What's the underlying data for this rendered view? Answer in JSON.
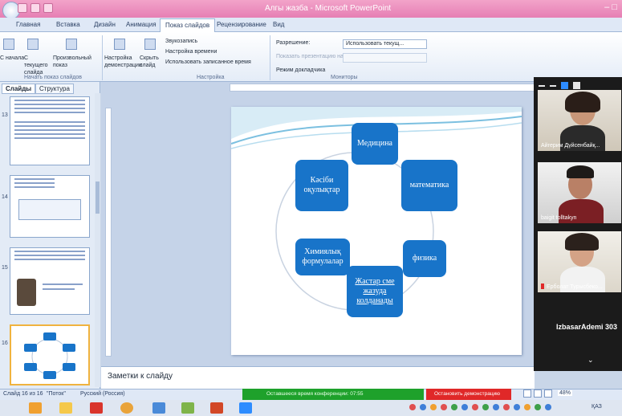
{
  "window": {
    "title": "Алгы жазба - Microsoft PowerPoint",
    "controls": "– □"
  },
  "ribbon_tabs": [
    {
      "label": "Главная"
    },
    {
      "label": "Вставка"
    },
    {
      "label": "Дизайн"
    },
    {
      "label": "Анимация"
    },
    {
      "label": "Показ слайдов",
      "active": true
    },
    {
      "label": "Рецензирование"
    },
    {
      "label": "Вид"
    }
  ],
  "ribbon": {
    "groups": [
      {
        "label": "Начать показ слайдов",
        "items": [
          "С начала",
          "С текущего слайда",
          "Произвольный показ"
        ]
      },
      {
        "label": "Настройка",
        "items": [
          "Настройка демонстрации",
          "Скрыть слайд",
          "Звукозапись",
          "Настройка времени",
          "Использовать записанное время"
        ]
      },
      {
        "label": "Мониторы",
        "items": [
          "Разрешение:",
          "Показать презентацию на:",
          "Режим докладчика"
        ]
      }
    ],
    "resolution_value": "Использовать текущ..."
  },
  "slides_pane": {
    "tabs": [
      "Слайды",
      "Структура"
    ],
    "slide_numbers": [
      "13",
      "14",
      "15",
      "16"
    ]
  },
  "slide": {
    "nodes": [
      {
        "text": "Медицина"
      },
      {
        "text": "математика"
      },
      {
        "text": "физика"
      },
      {
        "text": "Жастар сме жазуда колданады",
        "underline": true
      },
      {
        "text": "Химиялық формулалар"
      },
      {
        "text": "Кәсіби оқулықтар"
      }
    ],
    "accent_color": "#1874c9"
  },
  "notes": {
    "placeholder": "Заметки к слайду"
  },
  "status_bar": {
    "slide_counter": "Слайд 16 из 16",
    "theme": "\"Поток\"",
    "language": "Русский (Россия)",
    "conference_text": "Оставшееся время конференции: 07:55",
    "stop_sharing": "Остановить демонстрацию",
    "zoom": "48%"
  },
  "zoom_panel": {
    "participants": [
      {
        "name": "Айгерим Дүйсенбайқ..."
      },
      {
        "name": "baigit tolltakyn"
      },
      {
        "name": "Ерболат Турысбеко..."
      }
    ],
    "active_speaker": "IzbasarAdemi 303"
  },
  "taskbar": {
    "tray_text": "ҚАЗ"
  }
}
